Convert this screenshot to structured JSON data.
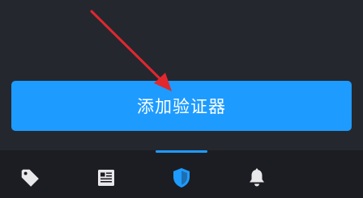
{
  "main": {
    "add_authenticator_label": "添加验证器"
  },
  "colors": {
    "accent": "#1e9bff",
    "background": "#25272f",
    "tabbar_background": "#1c1d22",
    "inactive_icon": "#e8e8ea",
    "annotation_arrow": "#e0282e"
  },
  "tabbar": {
    "tabs": [
      {
        "icon": "tag-icon",
        "active": false
      },
      {
        "icon": "newspaper-icon",
        "active": false
      },
      {
        "icon": "shield-icon",
        "active": true
      },
      {
        "icon": "bell-icon",
        "active": false
      }
    ]
  }
}
